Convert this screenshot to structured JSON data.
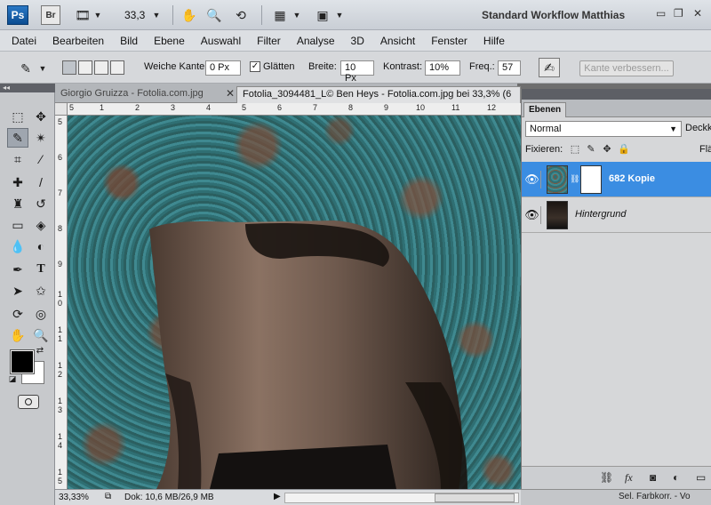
{
  "appbar": {
    "logo": "Ps",
    "bridge": "Br",
    "zoom": "33,3",
    "workspace": "Standard Workflow Matthias"
  },
  "menu": [
    "Datei",
    "Bearbeiten",
    "Bild",
    "Ebene",
    "Auswahl",
    "Filter",
    "Analyse",
    "3D",
    "Ansicht",
    "Fenster",
    "Hilfe"
  ],
  "options": {
    "feather_label": "Weiche Kante:",
    "feather_value": "0 Px",
    "smooth_label": "Glätten",
    "width_label": "Breite:",
    "width_value": "10 Px",
    "contrast_label": "Kontrast:",
    "contrast_value": "10%",
    "freq_label": "Freq.:",
    "freq_value": "57",
    "refine_button": "Kante verbessern..."
  },
  "tabs": [
    {
      "label": "Giorgio Gruizza - Fotolia.com.jpg",
      "active": false
    },
    {
      "label": "Fotolia_3094481_L© Ben Heys - Fotolia.com.jpg bei 33,3% (6",
      "active": true
    }
  ],
  "ruler_top": [
    "5",
    "1",
    "2",
    "3",
    "4",
    "5",
    "6",
    "7",
    "8",
    "9",
    "10",
    "11",
    "12"
  ],
  "ruler_left": [
    "5",
    "6",
    "7",
    "8",
    "9",
    "1",
    "0",
    "1",
    "1",
    "1",
    "2",
    "1",
    "3",
    "1",
    "4",
    "1",
    "5",
    "1",
    "6",
    "1",
    "7"
  ],
  "status": {
    "zoom": "33,33%",
    "doc": "Dok: 10,6 MB/26,9 MB"
  },
  "layers_panel": {
    "tab": "Ebenen",
    "blend_mode": "Normal",
    "opacity_label": "Deckkr",
    "lock_label": "Fixieren:",
    "fill_label": "Flä",
    "layers": [
      {
        "name": "682 Kopie",
        "selected": true
      },
      {
        "name": "Hintergrund",
        "selected": false
      }
    ]
  },
  "adjustments_strip": "Sel. Farbkorr. - Vo"
}
